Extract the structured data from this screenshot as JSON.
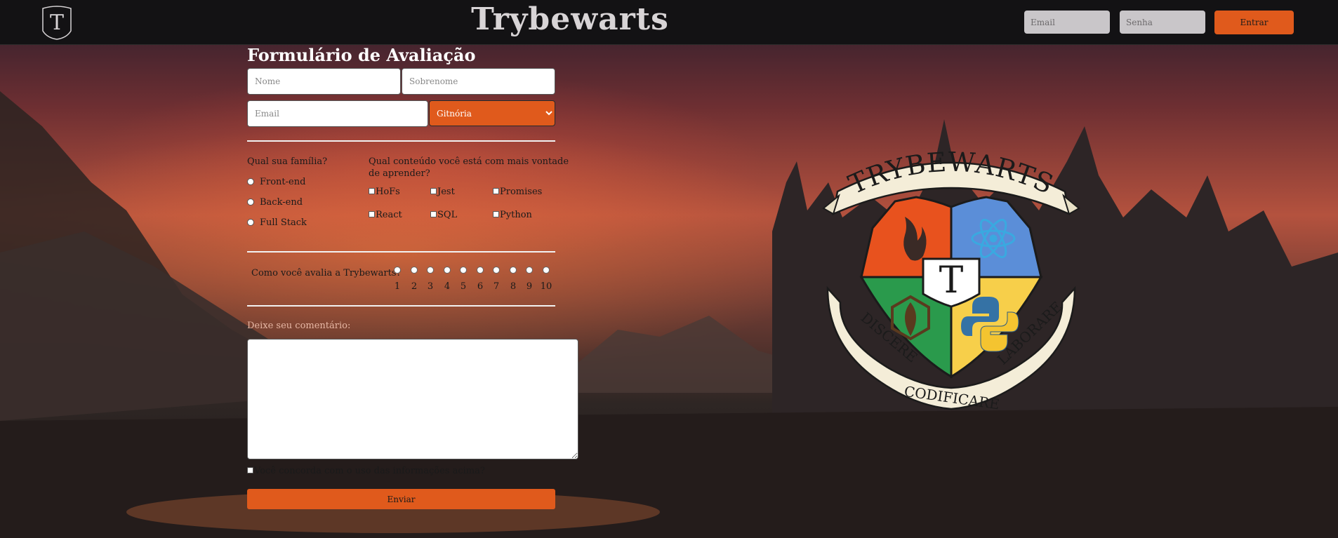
{
  "header": {
    "logo_letter": "T",
    "title": "Trybewarts",
    "login": {
      "email_placeholder": "Email",
      "password_placeholder": "Senha",
      "button_label": "Entrar"
    }
  },
  "form": {
    "title": "Formulário de Avaliação",
    "name_placeholder": "Nome",
    "lastname_placeholder": "Sobrenome",
    "email_placeholder": "Email",
    "house_selected": "Gitnória",
    "family": {
      "question": "Qual sua família?",
      "options": [
        "Front-end",
        "Back-end",
        "Full Stack"
      ]
    },
    "content": {
      "question_line1": "Qual conteúdo você está com mais vontade",
      "question_line2": "de aprender?",
      "options": [
        "HoFs",
        "Jest",
        "Promises",
        "React",
        "SQL",
        "Python"
      ]
    },
    "rating": {
      "question": "Como você avalia a Trybewarts?",
      "values": [
        "1",
        "2",
        "3",
        "4",
        "5",
        "6",
        "7",
        "8",
        "9",
        "10"
      ]
    },
    "comment_label": "Deixe seu comentário:",
    "agreement_label": "Você concorda com o uso das informações acima?",
    "submit_label": "Enviar"
  },
  "crest": {
    "banner_top": "TRYBEWARTS",
    "center_letter": "T",
    "motto_left": "DISCERE",
    "motto_bottom": "CODIFICARE",
    "motto_right": "LABORARE",
    "colors": {
      "red": "#e8521e",
      "blue": "#5b8ed8",
      "green": "#2a9a4c",
      "yellow": "#f7cf4a",
      "accent": "#e05a1c"
    }
  }
}
